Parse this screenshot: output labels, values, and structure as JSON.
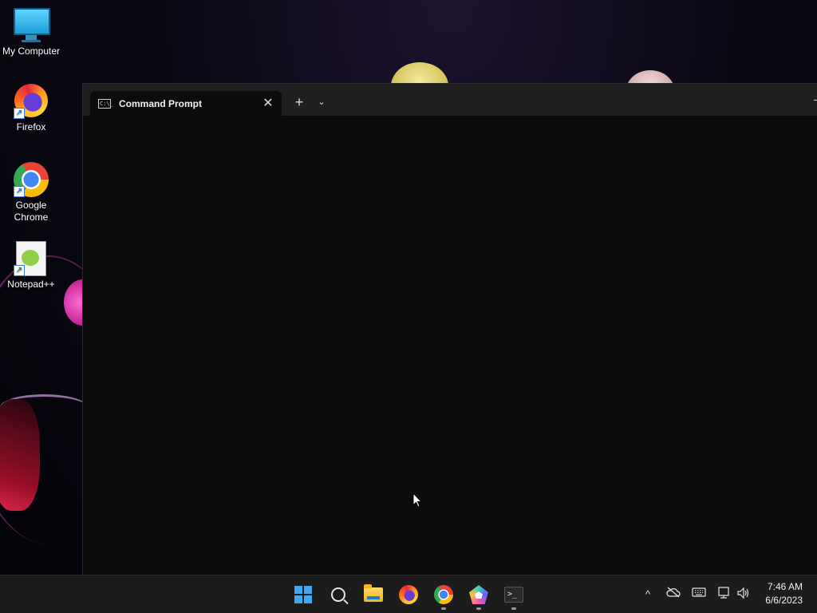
{
  "desktop": {
    "icons": [
      {
        "label": "My Computer",
        "icon": "computer-icon"
      },
      {
        "label": "Firefox",
        "icon": "firefox-icon"
      },
      {
        "label": "Google Chrome",
        "icon": "chrome-icon"
      },
      {
        "label": "Notepad++",
        "icon": "notepadpp-icon"
      }
    ]
  },
  "terminal": {
    "tab_title": "Command Prompt",
    "tab_icon_text": "C:\\_",
    "close_glyph": "✕",
    "newtab_glyph": "+",
    "dropdown_glyph": "⌄",
    "minimize_glyph": "—"
  },
  "taskbar": {
    "items": [
      {
        "name": "start-button",
        "icon": "windows-logo-icon"
      },
      {
        "name": "search-button",
        "icon": "search-icon"
      },
      {
        "name": "file-explorer-button",
        "icon": "folder-icon"
      },
      {
        "name": "firefox-button",
        "icon": "firefox-icon"
      },
      {
        "name": "chrome-button",
        "icon": "chrome-icon",
        "running": true
      },
      {
        "name": "app-button",
        "icon": "pentagon-app-icon",
        "running": true
      },
      {
        "name": "terminal-button",
        "icon": "terminal-icon",
        "running": true
      }
    ],
    "tray": {
      "overflow_glyph": "^",
      "icons": [
        "chevron-up-icon",
        "onedrive-icon",
        "keyboard-icon",
        "network-icon",
        "volume-icon"
      ]
    },
    "clock": {
      "time": "7:46 AM",
      "date": "6/6/2023"
    }
  }
}
